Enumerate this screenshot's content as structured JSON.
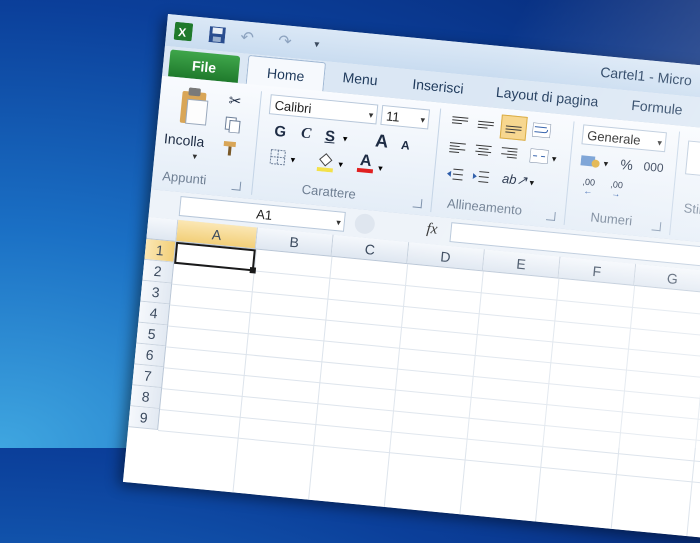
{
  "window_title": "Cartel1 - Micro",
  "tabs": {
    "file": "File",
    "home": "Home",
    "others": [
      "Menu",
      "Inserisci",
      "Layout di pagina",
      "Formule"
    ]
  },
  "ribbon": {
    "clipboard": {
      "paste_label": "Incolla",
      "group_label": "Appunti"
    },
    "font": {
      "font_name": "Calibri",
      "font_size": "11",
      "bold": "G",
      "italic": "C",
      "underline": "S",
      "grow": "A",
      "shrink": "A",
      "font_color_letter": "A",
      "group_label": "Carattere"
    },
    "alignment": {
      "group_label": "Allineamento"
    },
    "number": {
      "format": "Generale",
      "percent": "%",
      "thousands": "000",
      "inc_dec": ",00",
      "dec_dec": ",00",
      "group_label": "Numeri"
    },
    "styles": {
      "group_label": "Stili"
    }
  },
  "formula_bar": {
    "name_box": "A1",
    "fx": "fx"
  },
  "grid": {
    "columns": [
      "A",
      "B",
      "C",
      "D",
      "E",
      "F",
      "G"
    ],
    "rows": [
      "1",
      "2",
      "3",
      "4",
      "5",
      "6",
      "7",
      "8",
      "9"
    ],
    "active_cell": "A1"
  },
  "colors": {
    "accent": "#1f7a2c",
    "selection": "#f7d58a",
    "desktop": "#0b3f9a"
  }
}
